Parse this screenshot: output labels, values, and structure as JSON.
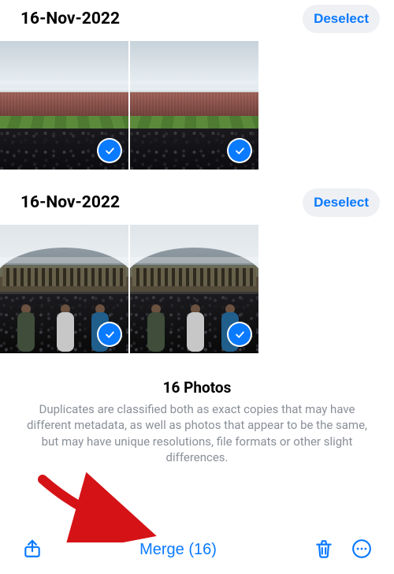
{
  "groups": [
    {
      "date": "16-Nov-2022",
      "deselect_label": "Deselect"
    },
    {
      "date": "16-Nov-2022",
      "deselect_label": "Deselect"
    }
  ],
  "info": {
    "count_label": "16 Photos",
    "description": "Duplicates are classified both as exact copies that may have different metadata, as well as photos that appear to be the same, but may have unique resolutions, file formats or other slight differences."
  },
  "toolbar": {
    "merge_label": "Merge (16)"
  }
}
